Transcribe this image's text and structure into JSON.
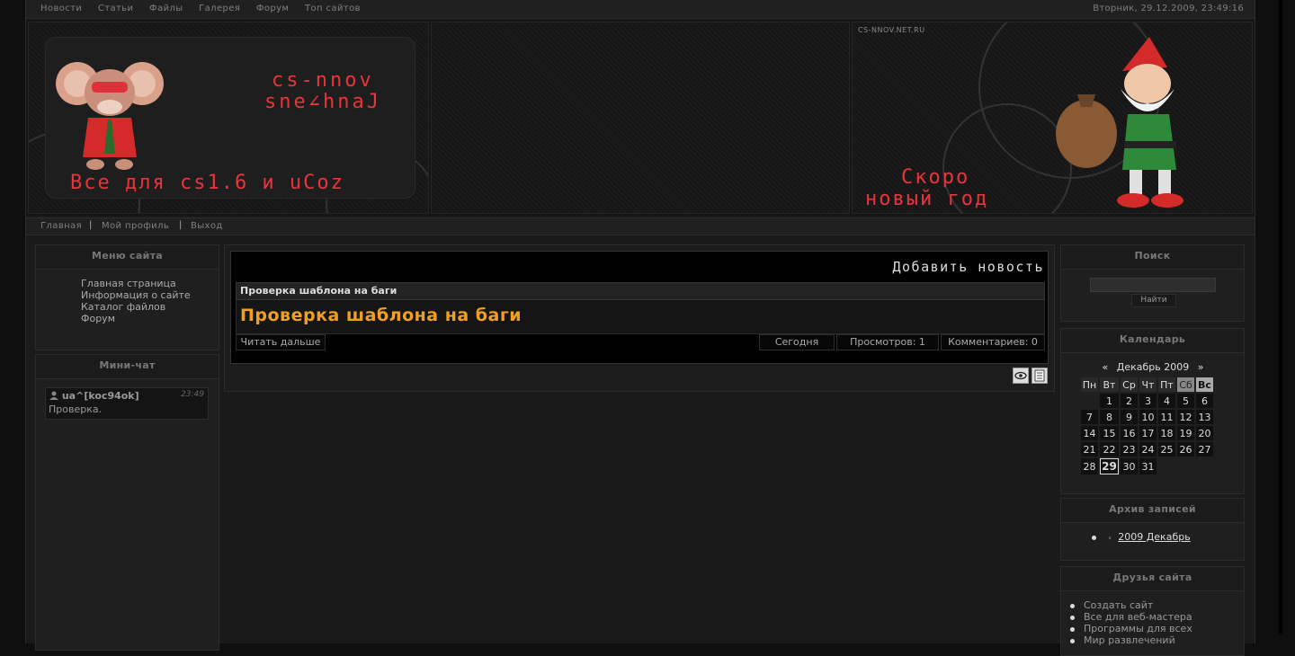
{
  "topnav": [
    "Новости",
    "Статьи",
    "Файлы",
    "Галерея",
    "Форум",
    "Топ сайтов"
  ],
  "datetime": "Вторник, 29.12.2009, 23:49:16",
  "header": {
    "brand_line1": "cs-nnov",
    "brand_line2": "sne∠hnaJ",
    "slogan": "Все для cs1.6 и uCoz",
    "site_url": "CS-NNOV.NET.RU",
    "new_year_line1": "Скоро",
    "new_year_line2": "новый год"
  },
  "subnav": [
    "Главная",
    "Мой профиль",
    "Выход"
  ],
  "menu": {
    "title": "Меню сайта",
    "items": [
      "Главная страница",
      "Информация о сайте",
      "Каталог файлов",
      "Форум"
    ]
  },
  "minichat": {
    "title": "Мини-чат",
    "user": "ua^[koc94ok]",
    "time": "23:49",
    "text": "Проверка."
  },
  "news": {
    "add_label": "Добавить новость",
    "header": "Проверка шаблона на баги",
    "title": "Проверка шаблона на баги",
    "read_more": "Читать дальше",
    "date": "Сегодня",
    "views": "Просмотров: 1",
    "comments": "Комментариев: 0"
  },
  "search": {
    "title": "Поиск",
    "button": "Найти"
  },
  "calendar": {
    "title": "Календарь",
    "prev": "«",
    "month": "Декабрь 2009",
    "next": "»",
    "weekdays": [
      "Пн",
      "Вт",
      "Ср",
      "Чт",
      "Пт",
      "Сб",
      "Вс"
    ],
    "weeks": [
      [
        "",
        "1",
        "2",
        "3",
        "4",
        "5",
        "6"
      ],
      [
        "7",
        "8",
        "9",
        "10",
        "11",
        "12",
        "13"
      ],
      [
        "14",
        "15",
        "16",
        "17",
        "18",
        "19",
        "20"
      ],
      [
        "21",
        "22",
        "23",
        "24",
        "25",
        "26",
        "27"
      ],
      [
        "28",
        "29",
        "30",
        "31",
        "",
        "",
        ""
      ]
    ],
    "today": "29"
  },
  "archive": {
    "title": "Архив записей",
    "items": [
      "2009 Декабрь"
    ]
  },
  "friends": {
    "title": "Друзья сайта",
    "items": [
      "Создать сайт",
      "Все для веб-мастера",
      "Программы для всех",
      "Мир развлечений"
    ]
  },
  "colors": {
    "accent_red": "#e8343a",
    "news_title": "#f0a020",
    "background": "#1a1a1a"
  }
}
